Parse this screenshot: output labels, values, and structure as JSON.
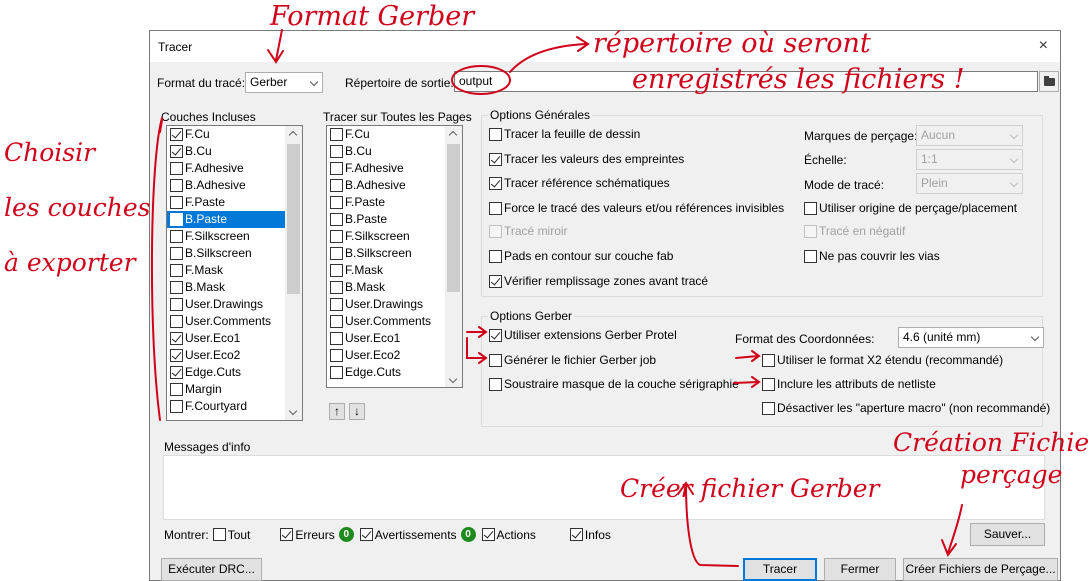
{
  "window": {
    "title": "Tracer",
    "close_icon": "×"
  },
  "top_bar": {
    "format_label": "Format du tracé:",
    "format_value": "Gerber",
    "output_dir_label": "Répertoire de sortie:",
    "output_dir_value": "output"
  },
  "layers_included": {
    "title": "Couches Incluses",
    "items": [
      {
        "label": "F.Cu",
        "checked": true,
        "selected": false
      },
      {
        "label": "B.Cu",
        "checked": true,
        "selected": false
      },
      {
        "label": "F.Adhesive",
        "checked": false,
        "selected": false
      },
      {
        "label": "B.Adhesive",
        "checked": false,
        "selected": false
      },
      {
        "label": "F.Paste",
        "checked": false,
        "selected": false
      },
      {
        "label": "B.Paste",
        "checked": false,
        "selected": true
      },
      {
        "label": "F.Silkscreen",
        "checked": false,
        "selected": false
      },
      {
        "label": "B.Silkscreen",
        "checked": false,
        "selected": false
      },
      {
        "label": "F.Mask",
        "checked": false,
        "selected": false
      },
      {
        "label": "B.Mask",
        "checked": false,
        "selected": false
      },
      {
        "label": "User.Drawings",
        "checked": false,
        "selected": false
      },
      {
        "label": "User.Comments",
        "checked": false,
        "selected": false
      },
      {
        "label": "User.Eco1",
        "checked": true,
        "selected": false
      },
      {
        "label": "User.Eco2",
        "checked": true,
        "selected": false
      },
      {
        "label": "Edge.Cuts",
        "checked": true,
        "selected": false
      },
      {
        "label": "Margin",
        "checked": false,
        "selected": false
      },
      {
        "label": "F.Courtyard",
        "checked": false,
        "selected": false
      }
    ]
  },
  "all_pages": {
    "title": "Tracer sur Toutes les Pages",
    "items": [
      {
        "label": "F.Cu",
        "checked": false
      },
      {
        "label": "B.Cu",
        "checked": false
      },
      {
        "label": "F.Adhesive",
        "checked": false
      },
      {
        "label": "B.Adhesive",
        "checked": false
      },
      {
        "label": "F.Paste",
        "checked": false
      },
      {
        "label": "B.Paste",
        "checked": false
      },
      {
        "label": "F.Silkscreen",
        "checked": false
      },
      {
        "label": "B.Silkscreen",
        "checked": false
      },
      {
        "label": "F.Mask",
        "checked": false
      },
      {
        "label": "B.Mask",
        "checked": false
      },
      {
        "label": "User.Drawings",
        "checked": false
      },
      {
        "label": "User.Comments",
        "checked": false
      },
      {
        "label": "User.Eco1",
        "checked": false
      },
      {
        "label": "User.Eco2",
        "checked": false
      },
      {
        "label": "Edge.Cuts",
        "checked": false
      }
    ],
    "up_arrow": "↑",
    "down_arrow": "↓"
  },
  "general_options": {
    "title": "Options Générales",
    "plot_sheet": "Tracer la feuille de dessin",
    "plot_values": "Tracer les valeurs des empreintes",
    "plot_refs": "Tracer référence  schématiques",
    "force_invisible": "Force le tracé des valeurs et/ou références invisibles",
    "mirror": "Tracé miroir",
    "pads_outline": "Pads en contour sur couche fab",
    "check_zones": "Vérifier remplissage zones avant tracé",
    "drill_marks_label": "Marques de perçage:",
    "drill_marks_value": "Aucun",
    "scale_label": "Échelle:",
    "scale_value": "1:1",
    "plot_mode_label": "Mode de tracé:",
    "plot_mode_value": "Plein",
    "use_aux_origin": "Utiliser origine de perçage/placement",
    "negative": "Tracé en négatif",
    "no_tent_vias": "Ne pas couvrir les vias"
  },
  "gerber_options": {
    "title": "Options Gerber",
    "protel_ext": "Utiliser extensions Gerber Protel",
    "job_file": "Générer le fichier Gerber job",
    "subtract_mask": "Soustraire masque de la couche sérigraphie",
    "coord_label": "Format des Coordonnées:",
    "coord_value": "4.6 (unité mm)",
    "x2_format": "Utiliser le format X2 étendu (recommandé)",
    "netlist_attrs": "Inclure les attributs de netliste",
    "disable_aperture": "Désactiver les \"aperture macro\" (non recommandé)"
  },
  "messages": {
    "title": "Messages d'info",
    "show_label": "Montrer:",
    "all": "Tout",
    "errors": "Erreurs",
    "errors_count": "0",
    "warnings": "Avertissements",
    "warnings_count": "0",
    "actions": "Actions",
    "infos": "Infos",
    "save": "Sauver..."
  },
  "footer": {
    "run_drc": "Exécuter DRC...",
    "plot": "Tracer",
    "close": "Fermer",
    "create_drill": "Créer Fichiers de Perçage..."
  },
  "annotations": {
    "format_gerber": "Format Gerber",
    "repertoire_1": "répertoire où seront",
    "repertoire_2": "enregistrés les fichiers !",
    "choisir": "Choisir",
    "les_couches": "les couches",
    "a_exporter": "à exporter",
    "creer_gerber": "Créer fichier Gerber",
    "creation_1": "Création Fichiers",
    "creation_2": "perçage",
    "accent_color": "#d0021b"
  }
}
